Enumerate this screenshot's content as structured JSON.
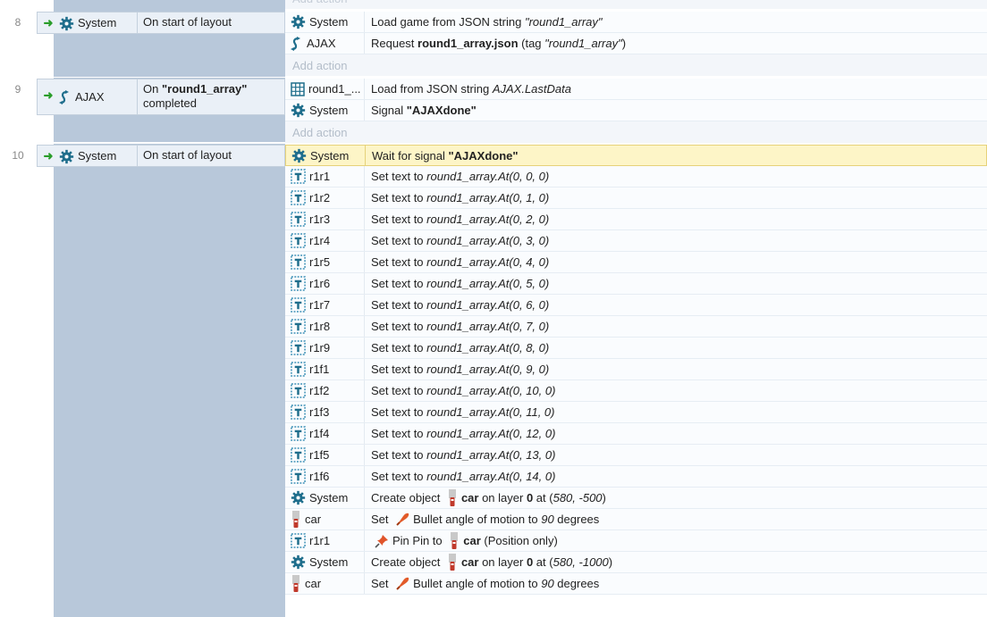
{
  "events": [
    {
      "number": "8",
      "condition": {
        "object": "System",
        "icon": "gear-icon",
        "text": "On start of layout"
      },
      "actions": [
        {
          "object": "System",
          "icon": "gear-icon",
          "parts": [
            {
              "t": "Load game from JSON string "
            },
            {
              "t": "\"round1_array\"",
              "s": "i"
            }
          ]
        },
        {
          "object": "AJAX",
          "icon": "ajax-icon",
          "parts": [
            {
              "t": "Request "
            },
            {
              "t": "round1_array.json",
              "s": "b"
            },
            {
              "t": " (tag "
            },
            {
              "t": "\"round1_array\"",
              "s": "i"
            },
            {
              "t": ")"
            }
          ]
        }
      ],
      "add_action": "Add action"
    },
    {
      "number": "9",
      "condition": {
        "object": "AJAX",
        "icon": "ajax-icon",
        "text_prefix": "On ",
        "text_bold": "\"round1_array\"",
        "text_suffix": "completed"
      },
      "actions": [
        {
          "object": "round1_...",
          "icon": "array-grid-icon",
          "parts": [
            {
              "t": "Load from JSON string "
            },
            {
              "t": "AJAX.LastData",
              "s": "i"
            }
          ]
        },
        {
          "object": "System",
          "icon": "gear-icon",
          "parts": [
            {
              "t": "Signal "
            },
            {
              "t": "\"AJAXdone\"",
              "s": "b"
            }
          ]
        }
      ],
      "add_action": "Add action"
    },
    {
      "number": "10",
      "condition": {
        "object": "System",
        "icon": "gear-icon",
        "text": "On start of layout"
      },
      "actions": [
        {
          "object": "System",
          "icon": "gear-icon",
          "highlight": true,
          "parts": [
            {
              "t": "Wait for signal "
            },
            {
              "t": "\"AJAXdone\"",
              "s": "b"
            }
          ]
        },
        {
          "object": "r1r1",
          "icon": "text-object-icon",
          "parts": [
            {
              "t": "Set text to "
            },
            {
              "t": "round1_array.At(0, 0, 0)",
              "s": "i"
            }
          ]
        },
        {
          "object": "r1r2",
          "icon": "text-object-icon",
          "parts": [
            {
              "t": "Set text to "
            },
            {
              "t": "round1_array.At(0, 1, 0)",
              "s": "i"
            }
          ]
        },
        {
          "object": "r1r3",
          "icon": "text-object-icon",
          "parts": [
            {
              "t": "Set text to "
            },
            {
              "t": "round1_array.At(0, 2, 0)",
              "s": "i"
            }
          ]
        },
        {
          "object": "r1r4",
          "icon": "text-object-icon",
          "parts": [
            {
              "t": "Set text to "
            },
            {
              "t": "round1_array.At(0, 3, 0)",
              "s": "i"
            }
          ]
        },
        {
          "object": "r1r5",
          "icon": "text-object-icon",
          "parts": [
            {
              "t": "Set text to "
            },
            {
              "t": "round1_array.At(0, 4, 0)",
              "s": "i"
            }
          ]
        },
        {
          "object": "r1r6",
          "icon": "text-object-icon",
          "parts": [
            {
              "t": "Set text to "
            },
            {
              "t": "round1_array.At(0, 5, 0)",
              "s": "i"
            }
          ]
        },
        {
          "object": "r1r7",
          "icon": "text-object-icon",
          "parts": [
            {
              "t": "Set text to "
            },
            {
              "t": "round1_array.At(0, 6, 0)",
              "s": "i"
            }
          ]
        },
        {
          "object": "r1r8",
          "icon": "text-object-icon",
          "parts": [
            {
              "t": "Set text to "
            },
            {
              "t": "round1_array.At(0, 7, 0)",
              "s": "i"
            }
          ]
        },
        {
          "object": "r1r9",
          "icon": "text-object-icon",
          "parts": [
            {
              "t": "Set text to "
            },
            {
              "t": "round1_array.At(0, 8, 0)",
              "s": "i"
            }
          ]
        },
        {
          "object": "r1f1",
          "icon": "text-object-icon",
          "parts": [
            {
              "t": "Set text to "
            },
            {
              "t": "round1_array.At(0, 9, 0)",
              "s": "i"
            }
          ]
        },
        {
          "object": "r1f2",
          "icon": "text-object-icon",
          "parts": [
            {
              "t": "Set text to "
            },
            {
              "t": "round1_array.At(0, 10, 0)",
              "s": "i"
            }
          ]
        },
        {
          "object": "r1f3",
          "icon": "text-object-icon",
          "parts": [
            {
              "t": "Set text to "
            },
            {
              "t": "round1_array.At(0, 11, 0)",
              "s": "i"
            }
          ]
        },
        {
          "object": "r1f4",
          "icon": "text-object-icon",
          "parts": [
            {
              "t": "Set text to "
            },
            {
              "t": "round1_array.At(0, 12, 0)",
              "s": "i"
            }
          ]
        },
        {
          "object": "r1f5",
          "icon": "text-object-icon",
          "parts": [
            {
              "t": "Set text to "
            },
            {
              "t": "round1_array.At(0, 13, 0)",
              "s": "i"
            }
          ]
        },
        {
          "object": "r1f6",
          "icon": "text-object-icon",
          "parts": [
            {
              "t": "Set text to "
            },
            {
              "t": "round1_array.At(0, 14, 0)",
              "s": "i"
            }
          ]
        },
        {
          "object": "System",
          "icon": "gear-icon",
          "parts": [
            {
              "t": "Create object "
            },
            {
              "icon": "car-icon"
            },
            {
              "t": "car",
              "s": "b"
            },
            {
              "t": " on layer "
            },
            {
              "t": "0",
              "s": "b"
            },
            {
              "t": " at ("
            },
            {
              "t": "580, -500",
              "s": "i"
            },
            {
              "t": ")"
            }
          ]
        },
        {
          "object": "car",
          "icon": "car-icon",
          "parts": [
            {
              "t": "Set "
            },
            {
              "icon": "bullet-icon"
            },
            {
              "t": "Bullet angle of motion to "
            },
            {
              "t": "90",
              "s": "i"
            },
            {
              "t": " degrees"
            }
          ]
        },
        {
          "object": "r1r1",
          "icon": "text-object-icon",
          "parts": [
            {
              "icon": "pin-icon"
            },
            {
              "t": "Pin Pin to "
            },
            {
              "icon": "car-icon"
            },
            {
              "t": "car",
              "s": "b"
            },
            {
              "t": " (Position only)"
            }
          ]
        },
        {
          "object": "System",
          "icon": "gear-icon",
          "parts": [
            {
              "t": "Create object "
            },
            {
              "icon": "car-icon"
            },
            {
              "t": "car",
              "s": "b"
            },
            {
              "t": " on layer "
            },
            {
              "t": "0",
              "s": "b"
            },
            {
              "t": " at ("
            },
            {
              "t": "580, -1000",
              "s": "i"
            },
            {
              "t": ")"
            }
          ]
        },
        {
          "object": "car",
          "icon": "car-icon",
          "parts": [
            {
              "t": "Set "
            },
            {
              "icon": "bullet-icon"
            },
            {
              "t": "Bullet angle of motion to "
            },
            {
              "t": "90",
              "s": "i"
            },
            {
              "t": " degrees"
            }
          ]
        }
      ]
    }
  ],
  "colors": {
    "gutter": "#b8c8da",
    "condition_bg": "#eaf0f7",
    "highlight_bg": "#fdf5c7",
    "trigger_arrow": "#2a9d2a",
    "gear": "#1f6e8c"
  }
}
